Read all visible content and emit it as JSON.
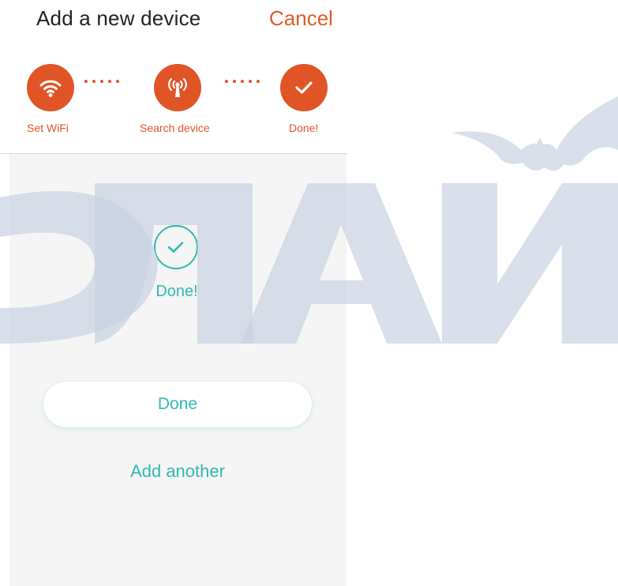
{
  "header": {
    "title": "Add a new device",
    "cancel_label": "Cancel"
  },
  "stepper": {
    "steps": [
      {
        "label": "Set WiFi",
        "icon": "wifi-icon"
      },
      {
        "label": "Search device",
        "icon": "antenna-icon"
      },
      {
        "label": "Done!",
        "icon": "checkmark-icon"
      }
    ],
    "accent_color": "#e05426"
  },
  "result": {
    "status_text": "Done!",
    "icon": "check-circle-icon",
    "accent_color": "#2fb8b3"
  },
  "actions": {
    "done_label": "Done",
    "add_another_label": "Add another"
  }
}
